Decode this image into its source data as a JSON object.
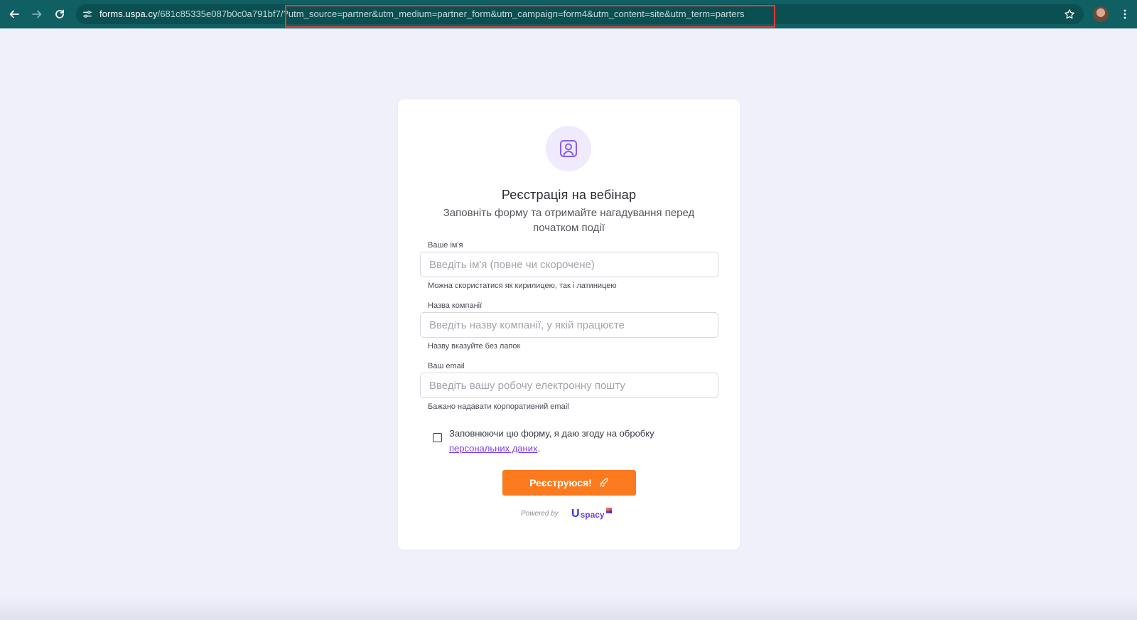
{
  "browser": {
    "url_host": "forms.uspa.cy",
    "url_path": "/681c85335e087b0c0a791bf7/",
    "url_query": "?utm_source=partner&utm_medium=partner_form&utm_campaign=form4&utm_content=site&utm_term=parters",
    "icons": {
      "back": "back-arrow-icon",
      "forward": "forward-arrow-icon",
      "reload": "reload-icon",
      "site_info": "site-settings-icon",
      "bookmark": "star-icon",
      "menu": "kebab-menu-icon"
    },
    "highlight_color": "#e53935",
    "bar_color": "#0f5f63"
  },
  "form": {
    "icon": "user-profile-icon",
    "title": "Реєстрація на вебінар",
    "subtitle": "Заповніть форму та отримайте нагадування перед початком події",
    "fields": [
      {
        "label": "Ваше ім'я",
        "placeholder": "Введіть ім'я (повне чи скорочене)",
        "value": "",
        "hint": "Можна скористатися як кирилицею, так і латиницею"
      },
      {
        "label": "Назва компанії",
        "placeholder": "Введіть назву компанії, у якій працюєте",
        "value": "",
        "hint": "Назву вказуйте без лапок"
      },
      {
        "label": "Ваш email",
        "placeholder": "Введіть вашу робочу електронну пошту",
        "value": "",
        "hint": "Бажано надавати корпоративний email"
      }
    ],
    "consent": {
      "checked": false,
      "text": "Заповнюючи цю форму, я даю згоду на обробку",
      "link_text": "персональних даних",
      "suffix": "."
    },
    "submit_label": "Реєструюся!",
    "submit_icon": "rocket-icon",
    "accent_color": "#fb7a1e",
    "powered_by": "Powered by",
    "brand_logo_text": "spacy"
  }
}
